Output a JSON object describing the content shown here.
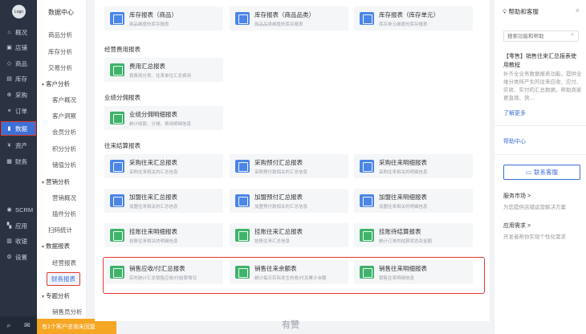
{
  "nav": {
    "logo": "Logo",
    "items": [
      {
        "label": "概况",
        "icon": "home-icon",
        "glyph": "⌂"
      },
      {
        "label": "店铺",
        "icon": "store-icon",
        "glyph": "▣"
      },
      {
        "label": "商品",
        "icon": "tag-icon",
        "glyph": "◇"
      },
      {
        "label": "库存",
        "icon": "box-icon",
        "glyph": "▤"
      },
      {
        "label": "采购",
        "icon": "cart-icon",
        "glyph": "⊕"
      },
      {
        "label": "订单",
        "icon": "order-icon",
        "glyph": "≡"
      },
      {
        "label": "数据",
        "icon": "chart-icon",
        "glyph": "▮"
      },
      {
        "label": "资产",
        "icon": "coin-icon",
        "glyph": "¥"
      },
      {
        "label": "财务",
        "icon": "wallet-icon",
        "glyph": "▦"
      },
      {
        "label": "SCRM",
        "icon": "scrm-icon",
        "glyph": "◉"
      },
      {
        "label": "应用",
        "icon": "apps-icon",
        "glyph": "▚"
      },
      {
        "label": "收银",
        "icon": "cashier-icon",
        "glyph": "▥"
      },
      {
        "label": "设置",
        "icon": "gear-icon",
        "glyph": "⚙"
      }
    ],
    "bottom_icons": [
      "search-icon",
      "chat-icon"
    ]
  },
  "sub": {
    "title": "数据中心",
    "items": [
      {
        "label": "商品分析",
        "kind": "lvl1"
      },
      {
        "label": "库存分析",
        "kind": "lvl1"
      },
      {
        "label": "交易分析",
        "kind": "lvl1"
      },
      {
        "label": "客户分析",
        "kind": "group"
      },
      {
        "label": "客户概况",
        "kind": "lvl2"
      },
      {
        "label": "客户洞察",
        "kind": "lvl2"
      },
      {
        "label": "会员分析",
        "kind": "lvl2"
      },
      {
        "label": "积分分析",
        "kind": "lvl2"
      },
      {
        "label": "储值分析",
        "kind": "lvl2"
      },
      {
        "label": "营销分析",
        "kind": "group"
      },
      {
        "label": "营销概况",
        "kind": "lvl2"
      },
      {
        "label": "插件分析",
        "kind": "lvl2"
      },
      {
        "label": "扫码统计",
        "kind": "lvl1"
      },
      {
        "label": "数据报表",
        "kind": "group"
      },
      {
        "label": "经营报表",
        "kind": "lvl2"
      },
      {
        "label": "财务报表",
        "kind": "selected"
      },
      {
        "label": "专题分析",
        "kind": "group"
      },
      {
        "label": "销售员分析",
        "kind": "lvl2"
      }
    ]
  },
  "notice": "有1个客户咨询未回复",
  "main": {
    "top_cards": [
      {
        "name": "库存报表（商品）",
        "desc": "商品维度的库存报表",
        "color": "blue"
      },
      {
        "name": "库存报表（商品品类）",
        "desc": "商品品类维度的库存报表",
        "color": "blue"
      },
      {
        "name": "库存报表（库存单元）",
        "desc": "库存单元维度的库存报表",
        "color": "blue"
      }
    ],
    "sections": [
      {
        "title": "经营费用报表",
        "cards": [
          {
            "name": "费用汇总报表",
            "desc": "按费用分类、往来单位汇总费用",
            "color": "green"
          }
        ]
      },
      {
        "title": "业绩分佣报表",
        "cards": [
          {
            "name": "业绩分佣明细报表",
            "desc": "统计收款、分佣、费用明细信息",
            "color": "green"
          }
        ]
      },
      {
        "title": "往来结算报表",
        "cards": [
          {
            "name": "采购往来汇总报表",
            "desc": "采购往来相关的汇总信息",
            "color": "blue"
          },
          {
            "name": "采购预付汇总报表",
            "desc": "采购预付款相关的汇总信息",
            "color": "blue"
          },
          {
            "name": "采购往来明细报表",
            "desc": "采购往来相关的明细信息",
            "color": "blue"
          },
          {
            "name": "加盟往来汇总报表",
            "desc": "加盟往来相关的汇总信息",
            "color": "blue"
          },
          {
            "name": "加盟预付汇总报表",
            "desc": "加盟预付款相关的汇总信息",
            "color": "blue"
          },
          {
            "name": "加盟往来明细报表",
            "desc": "加盟往来相关的明细信息",
            "color": "blue"
          },
          {
            "name": "挂账往来明细报表",
            "desc": "挂账往来相关的明细信息",
            "color": "green"
          },
          {
            "name": "挂账往来汇总报表",
            "desc": "挂账往来汇总信息",
            "color": "green"
          },
          {
            "name": "挂账待结算报表",
            "desc": "统计订单的结算状态及金额",
            "color": "green"
          },
          {
            "name": "销售应收/付汇总报表",
            "desc": "实时统计汇总销售应收/付结算情况",
            "color": "green"
          },
          {
            "name": "销售往来余额表",
            "desc": "统计每天实际发生的收/付及累计余额",
            "color": "green"
          },
          {
            "name": "销售往来明细报表",
            "desc": "销售往来明细信息",
            "color": "green"
          }
        ]
      }
    ],
    "watermark": "有赞"
  },
  "help": {
    "title": "帮助和客服",
    "search_placeholder": "搜索功能和帮助",
    "article_title": "【零售】销售往来汇总报表使用教程",
    "article_body": "补齐全业务数据报表功能，提供全维分类所产生的往来应收、应付、实收、实付的汇总数据，帮助商家更直观、快...",
    "more_link": "了解更多",
    "center_link": "帮助中心",
    "contact_button": "联系客服",
    "market_title": "服务市场 >",
    "market_desc": "为您提供店铺运营解决方案",
    "needs_title": "应用需求 >",
    "needs_desc": "开发者帮你实现个性化需求"
  }
}
